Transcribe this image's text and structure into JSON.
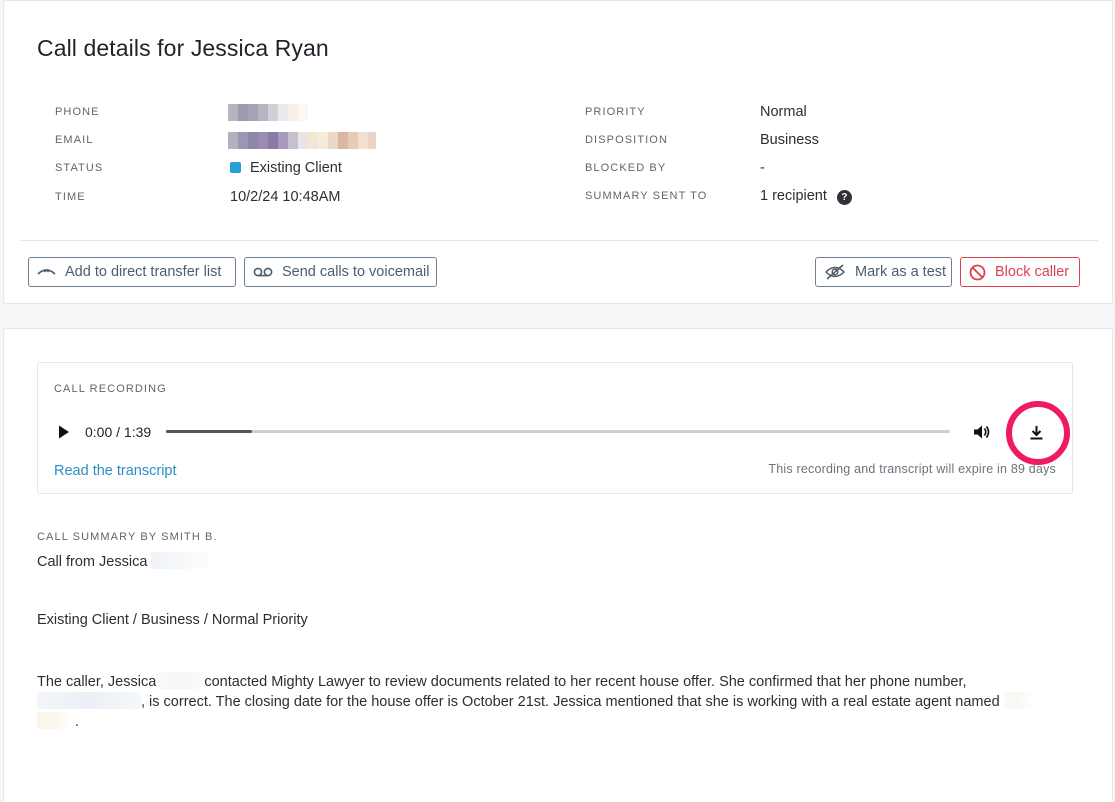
{
  "header": {
    "title": "Call details for Jessica Ryan"
  },
  "details_left": {
    "phone_label": "PHONE",
    "email_label": "EMAIL",
    "status_label": "STATUS",
    "status_value": "Existing Client",
    "status_color": "#2a9fd6",
    "time_label": "TIME",
    "time_value": "10/2/24 10:48AM"
  },
  "details_right": {
    "priority_label": "PRIORITY",
    "priority_value": "Normal",
    "disposition_label": "DISPOSITION",
    "disposition_value": "Business",
    "blocked_by_label": "BLOCKED BY",
    "blocked_by_value": "-",
    "summary_sent_label": "SUMMARY SENT TO",
    "summary_sent_value": "1 recipient",
    "help_icon": "?"
  },
  "actions": {
    "add_transfer": "Add to direct transfer list",
    "send_voicemail": "Send calls to voicemail",
    "mark_test": "Mark as a test",
    "block_caller": "Block caller"
  },
  "recording": {
    "label": "CALL RECORDING",
    "time_display": "0:00 / 1:39",
    "progress_fraction": 0.11,
    "transcript_link": "Read the transcript",
    "expire_note": "This recording and transcript will expire in 89 days",
    "highlight_color": "#ee1a66"
  },
  "summary": {
    "label": "CALL SUMMARY BY SMITH B.",
    "line1": "Call from Jessica",
    "line2": "Existing Client / Business / Normal Priority",
    "line3a": "The caller, Jessica",
    "line3b": "contacted Mighty Lawyer to review documents related to her recent house offer. She confirmed that her phone number,",
    "line4": ", is correct. The closing date for the house offer is October 21st. Jessica mentioned that she is working with a real estate agent named",
    "line5": "."
  }
}
